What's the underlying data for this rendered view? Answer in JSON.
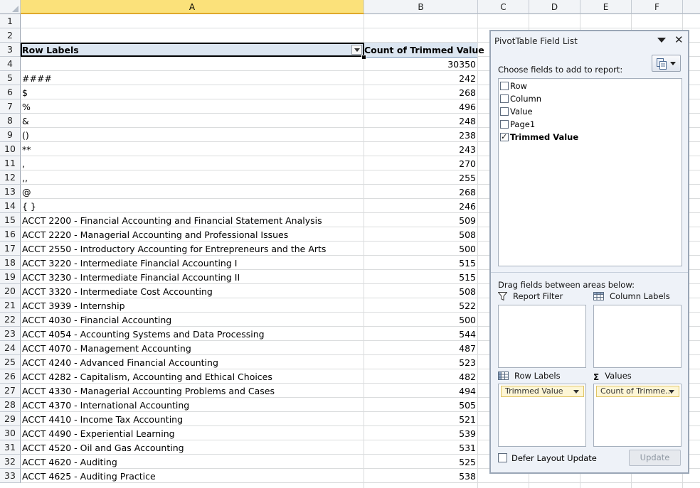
{
  "columns": [
    "A",
    "B",
    "C",
    "D",
    "E",
    "F"
  ],
  "selected_column": "A",
  "rows": [
    {
      "num": "1",
      "a": "",
      "b": ""
    },
    {
      "num": "2",
      "a": "",
      "b": ""
    },
    {
      "num": "3",
      "a": "Row Labels",
      "b": "Count of Trimmed Value"
    },
    {
      "num": "4",
      "a": "",
      "b": "30350"
    },
    {
      "num": "5",
      "a": "####",
      "b": "242"
    },
    {
      "num": "6",
      "a": "$",
      "b": "268"
    },
    {
      "num": "7",
      "a": "%",
      "b": "496"
    },
    {
      "num": "8",
      "a": "&",
      "b": "248"
    },
    {
      "num": "9",
      "a": "()",
      "b": "238"
    },
    {
      "num": "10",
      "a": "**",
      "b": "243"
    },
    {
      "num": "11",
      "a": ",",
      "b": "270"
    },
    {
      "num": "12",
      "a": ",,",
      "b": "255"
    },
    {
      "num": "13",
      "a": "@",
      "b": "268"
    },
    {
      "num": "14",
      "a": "{ }",
      "b": "246"
    },
    {
      "num": "15",
      "a": "ACCT 2200 - Financial Accounting and Financial Statement Analysis",
      "b": "509"
    },
    {
      "num": "16",
      "a": "ACCT 2220 - Managerial Accounting and Professional Issues",
      "b": "508"
    },
    {
      "num": "17",
      "a": "ACCT 2550 - Introductory Accounting for Entrepreneurs and the Arts",
      "b": "500"
    },
    {
      "num": "18",
      "a": "ACCT 3220 - Intermediate Financial Accounting I",
      "b": "515"
    },
    {
      "num": "19",
      "a": "ACCT 3230 - Intermediate Financial Accounting II",
      "b": "515"
    },
    {
      "num": "20",
      "a": "ACCT 3320 - Intermediate Cost Accounting",
      "b": "508"
    },
    {
      "num": "21",
      "a": "ACCT 3939 - Internship",
      "b": "522"
    },
    {
      "num": "22",
      "a": "ACCT 4030 - Financial Accounting",
      "b": "500"
    },
    {
      "num": "23",
      "a": "ACCT 4054 - Accounting Systems and Data Processing",
      "b": "544"
    },
    {
      "num": "24",
      "a": "ACCT 4070 - Management Accounting",
      "b": "487"
    },
    {
      "num": "25",
      "a": "ACCT 4240 - Advanced Financial Accounting",
      "b": "523"
    },
    {
      "num": "26",
      "a": "ACCT 4282 - Capitalism, Accounting and Ethical Choices",
      "b": "482"
    },
    {
      "num": "27",
      "a": "ACCT 4330 - Managerial Accounting Problems and Cases",
      "b": "494"
    },
    {
      "num": "28",
      "a": "ACCT 4370 - International Accounting",
      "b": "505"
    },
    {
      "num": "29",
      "a": "ACCT 4410 - Income Tax Accounting",
      "b": "521"
    },
    {
      "num": "30",
      "a": "ACCT 4490 - Experiential Learning",
      "b": "539"
    },
    {
      "num": "31",
      "a": "ACCT 4520 - Oil and Gas Accounting",
      "b": "531"
    },
    {
      "num": "32",
      "a": "ACCT 4620 - Auditing",
      "b": "525"
    },
    {
      "num": "33",
      "a": "ACCT 4625 - Auditing Practice",
      "b": "538"
    }
  ],
  "pivot": {
    "title": "PivotTable Field List",
    "dropdown_icon": "chevron-down-icon",
    "close_icon": "close-icon",
    "choose_label": "Choose fields to add to report:",
    "fields": [
      {
        "label": "Row",
        "checked": false
      },
      {
        "label": "Column",
        "checked": false
      },
      {
        "label": "Value",
        "checked": false
      },
      {
        "label": "Page1",
        "checked": false
      },
      {
        "label": "Trimmed Value",
        "checked": true
      }
    ],
    "drag_label": "Drag fields between areas below:",
    "report_filter_label": "Report Filter",
    "column_labels_label": "Column Labels",
    "row_labels_label": "Row Labels",
    "values_label": "Values",
    "row_chip": "Trimmed Value",
    "values_chip": "Count of Trimme...",
    "defer_label": "Defer Layout Update",
    "update_label": "Update"
  },
  "colors": {
    "selected_header": "#fbe17a",
    "pivot_header_band": "#dce6f1",
    "chip_fill": "#fdf6d6"
  }
}
